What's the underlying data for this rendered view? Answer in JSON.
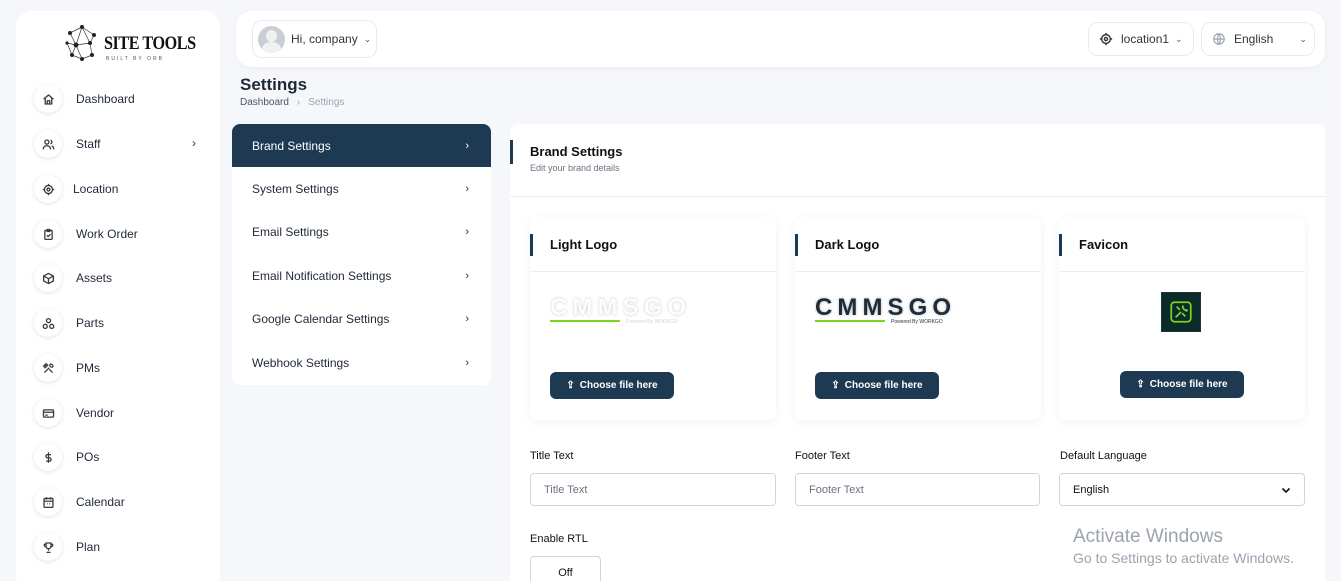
{
  "brand": {
    "name": "SITE TOOLS",
    "tagline": "BUILT BY ORB"
  },
  "sidebar": {
    "items": [
      {
        "label": "Dashboard",
        "icon": "home-icon"
      },
      {
        "label": "Staff",
        "icon": "users-icon",
        "has_submenu": true
      },
      {
        "label": "Location",
        "icon": "target-icon"
      },
      {
        "label": "Work Order",
        "icon": "clipboard-icon"
      },
      {
        "label": "Assets",
        "icon": "box-icon"
      },
      {
        "label": "Parts",
        "icon": "parts-icon"
      },
      {
        "label": "PMs",
        "icon": "tools-icon"
      },
      {
        "label": "Vendor",
        "icon": "card-icon"
      },
      {
        "label": "POs",
        "icon": "dollar-icon"
      },
      {
        "label": "Calendar",
        "icon": "calendar-icon"
      },
      {
        "label": "Plan",
        "icon": "trophy-icon"
      }
    ]
  },
  "topbar": {
    "user_greeting": "Hi, company",
    "location": "location1",
    "language": "English"
  },
  "page": {
    "title": "Settings",
    "breadcrumb": {
      "home": "Dashboard",
      "current": "Settings"
    }
  },
  "settings_menu": {
    "items": [
      {
        "label": "Brand Settings",
        "active": true
      },
      {
        "label": "System Settings"
      },
      {
        "label": "Email Settings"
      },
      {
        "label": "Email Notification Settings"
      },
      {
        "label": "Google Calendar Settings"
      },
      {
        "label": "Webhook Settings"
      }
    ]
  },
  "brand_settings": {
    "title": "Brand Settings",
    "subtitle": "Edit your brand details",
    "cards": {
      "light_logo": "Light Logo",
      "dark_logo": "Dark Logo",
      "favicon": "Favicon"
    },
    "choose_file_label": "Choose file here",
    "logo_text": "CMMSGO",
    "logo_powered": "Powered By WORKGO",
    "fields": {
      "title_text_label": "Title Text",
      "title_text_placeholder": "Title Text",
      "footer_text_label": "Footer Text",
      "footer_text_placeholder": "Footer Text",
      "default_language_label": "Default Language",
      "default_language_value": "English",
      "enable_rtl_label": "Enable RTL",
      "enable_rtl_value": "Off"
    }
  },
  "watermark": {
    "title": "Activate Windows",
    "subtitle": "Go to Settings to activate Windows."
  },
  "colors": {
    "primary": "#1e3a53",
    "accent_green": "#7ed321",
    "background": "#f6f7fb"
  }
}
